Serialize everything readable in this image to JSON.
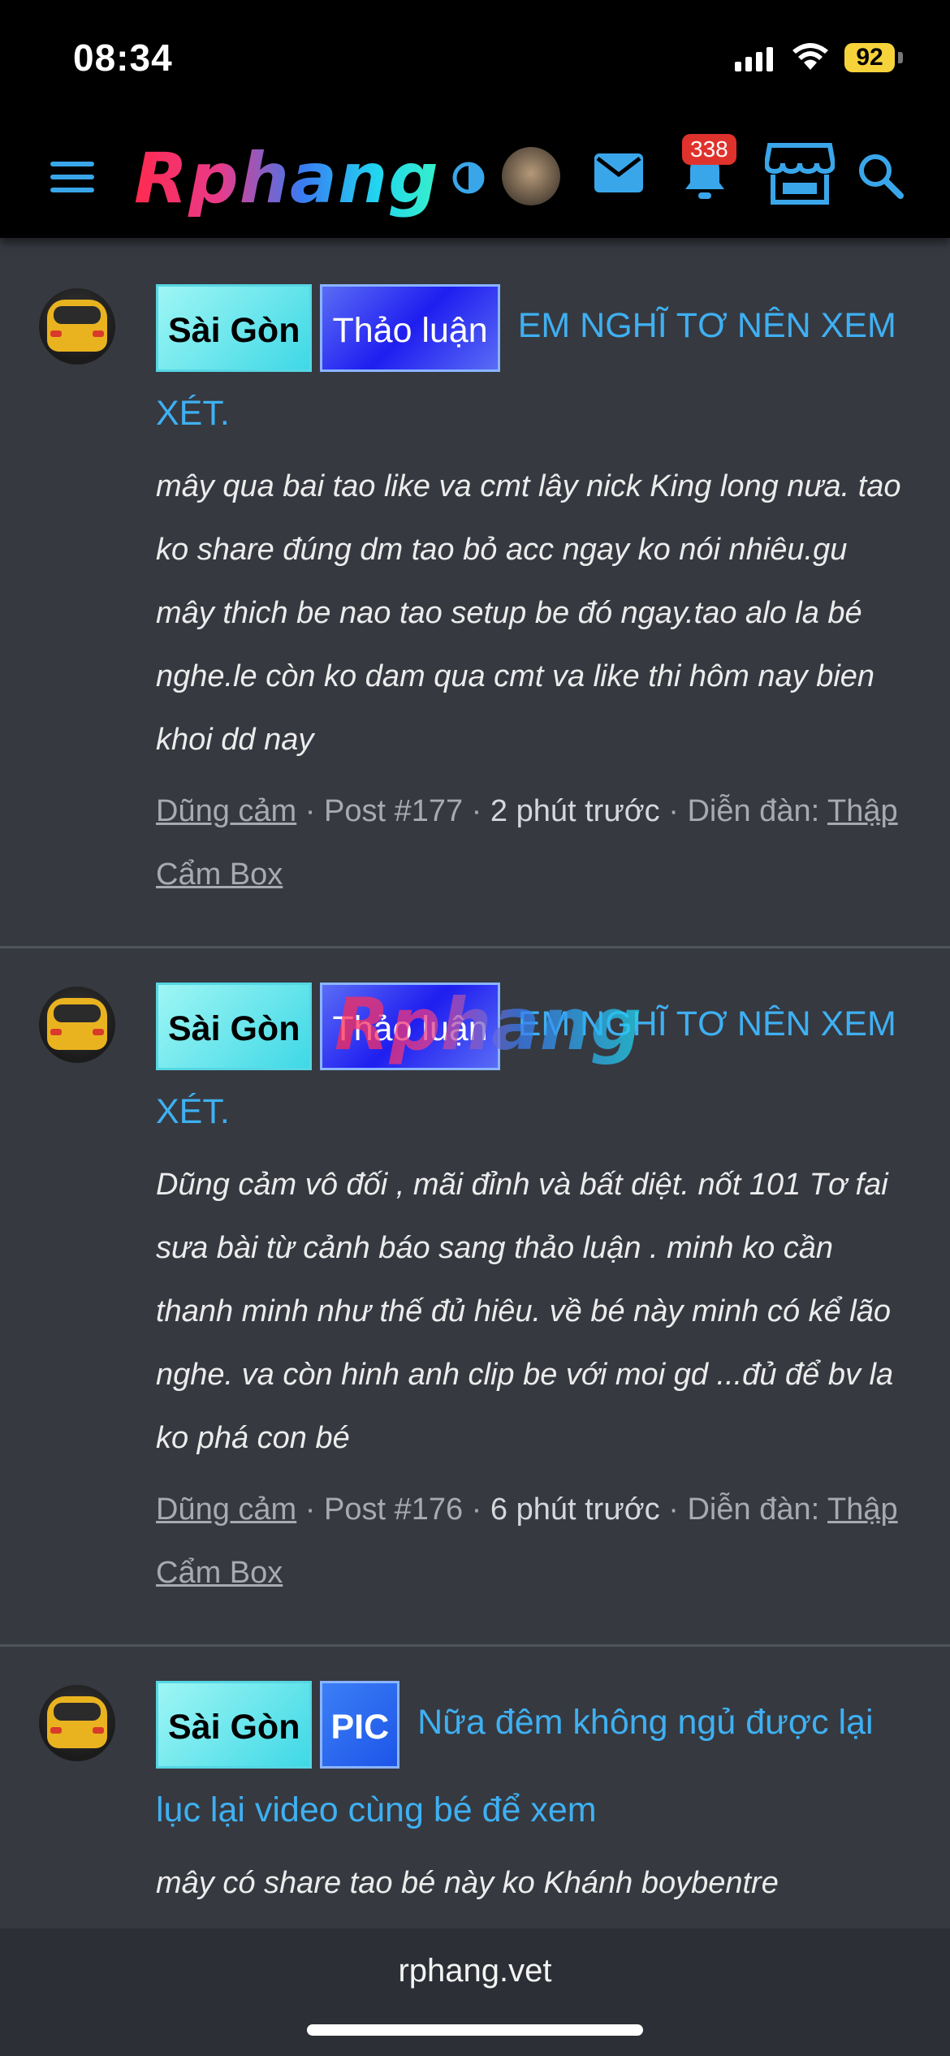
{
  "status_bar": {
    "time": "08:34",
    "battery": "92"
  },
  "header": {
    "logo": "Rphang",
    "notification_count": "338"
  },
  "posts": [
    {
      "prefix_city": "Sài Gòn",
      "prefix_type": "Thảo luận",
      "title": "EM NGHĨ TƠ NÊN XEM XÉT.",
      "body": "mây qua bai tao like va cmt lây nick King long nưa. tao ko share đúng dm tao bỏ acc ngay ko nói nhiêu.gu mây thich be nao tao setup be đó ngay.tao alo la bé nghe.le còn ko dam qua cmt va like thi hôm nay bien khoi dd nay",
      "author": "Dũng cảm",
      "post_no": "Post #177",
      "time": "2 phút trước",
      "forum_label": "Diễn đàn:",
      "forum": "Thập Cẩm Box"
    },
    {
      "prefix_city": "Sài Gòn",
      "prefix_type": "Thảo luận",
      "title": "EM NGHĨ TƠ NÊN XEM XÉT.",
      "body": "Dũng cảm vô đối , mãi đỉnh và bất diệt. nốt 101 Tơ fai sưa bài từ cảnh báo sang thảo luận . minh ko cần thanh minh như thế đủ hiêu. về bé này minh có kể lão nghe. va còn hinh anh clip be với moi gd ...đủ để bv la ko phá con bé",
      "author": "Dũng cảm",
      "post_no": "Post #176",
      "time": "6 phút trước",
      "forum_label": "Diễn đàn:",
      "forum": "Thập Cẩm Box"
    },
    {
      "prefix_city": "Sài Gòn",
      "prefix_type": "PIC",
      "title": "Nữa đêm không ngủ được lại lục lại video cùng bé để xem",
      "body": "mây có share tao bé này ko Khánh boybentre"
    }
  ],
  "watermark": "Rphang",
  "footer": {
    "url": "rphang.vet"
  }
}
